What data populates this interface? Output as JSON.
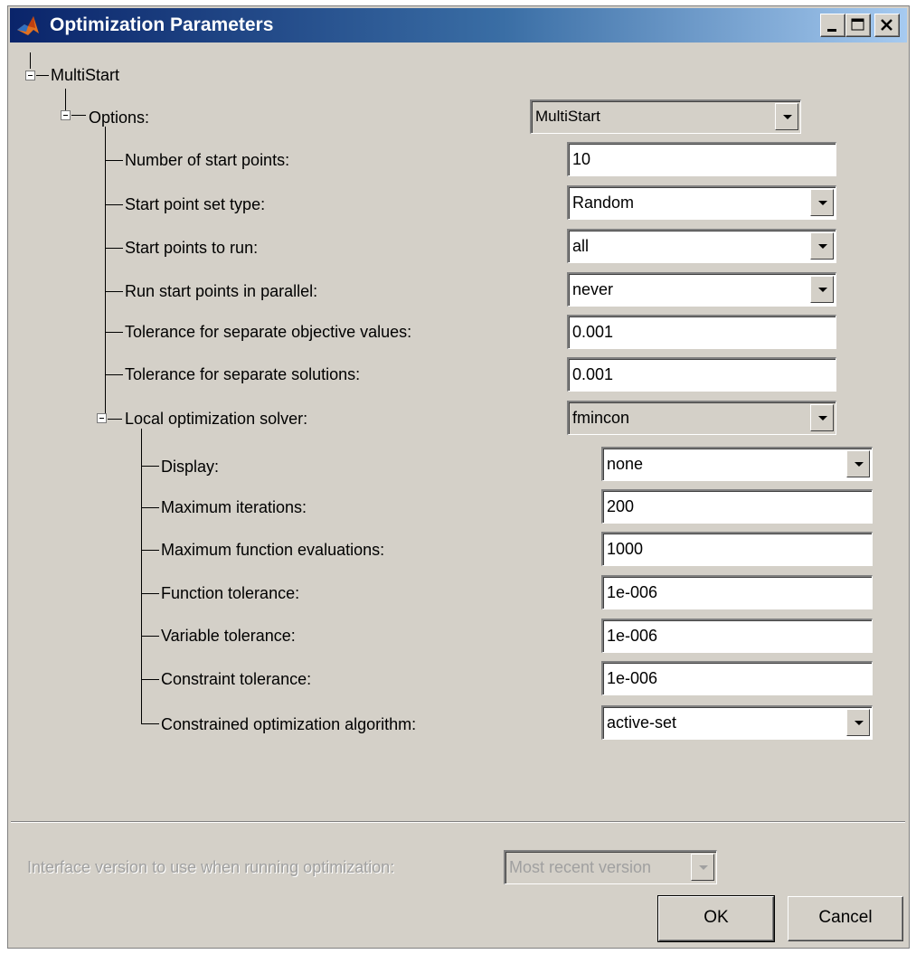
{
  "window": {
    "title": "Optimization Parameters",
    "icon": "matlab-icon",
    "controls": [
      "minimize-icon",
      "maximize-icon",
      "close-icon"
    ]
  },
  "tree": {
    "root_label": "MultiStart",
    "options": {
      "label": "Options:",
      "value": "MultiStart",
      "items": [
        {
          "label": "Number of start points:",
          "value": "10",
          "type": "text"
        },
        {
          "label": "Start point set type:",
          "value": "Random",
          "type": "dropdown"
        },
        {
          "label": "Start points to run:",
          "value": "all",
          "type": "dropdown"
        },
        {
          "label": "Run start points in parallel:",
          "value": "never",
          "type": "dropdown"
        },
        {
          "label": "Tolerance for separate objective values:",
          "value": "0.001",
          "type": "text"
        },
        {
          "label": "Tolerance for separate solutions:",
          "value": "0.001",
          "type": "text"
        }
      ],
      "local_solver": {
        "label": "Local optimization solver:",
        "value": "fmincon",
        "items": [
          {
            "label": "Display:",
            "value": "none",
            "type": "dropdown"
          },
          {
            "label": "Maximum iterations:",
            "value": "200",
            "type": "text"
          },
          {
            "label": "Maximum function evaluations:",
            "value": "1000",
            "type": "text"
          },
          {
            "label": "Function tolerance:",
            "value": "1e-006",
            "type": "text"
          },
          {
            "label": "Variable tolerance:",
            "value": "1e-006",
            "type": "text"
          },
          {
            "label": "Constraint tolerance:",
            "value": "1e-006",
            "type": "text"
          },
          {
            "label": "Constrained optimization algorithm:",
            "value": "active-set",
            "type": "dropdown"
          }
        ]
      }
    }
  },
  "footer": {
    "interface_label": "Interface version to use when running optimization:",
    "interface_value": "Most recent version",
    "ok_label": "OK",
    "cancel_label": "Cancel"
  }
}
